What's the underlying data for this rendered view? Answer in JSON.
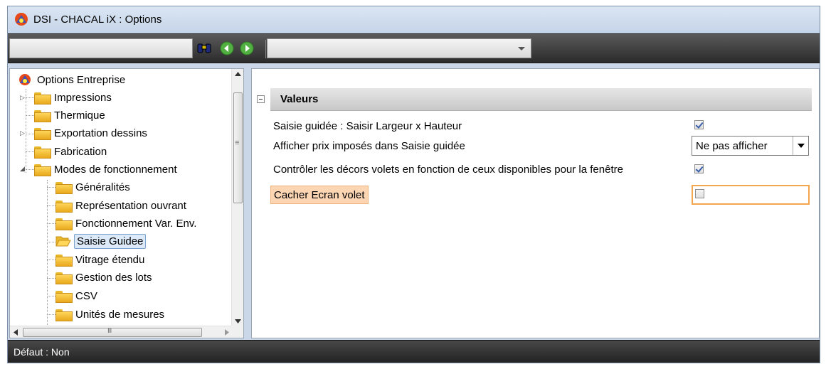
{
  "window": {
    "title": "DSI - CHACAL iX : Options"
  },
  "toolbar": {
    "search_value": "",
    "search_icon": "binoculars-icon",
    "back_icon": "back-arrow-icon",
    "forward_icon": "forward-arrow-icon",
    "combo_value": ""
  },
  "tree": {
    "root": "Options Entreprise",
    "items": [
      {
        "label": "Impressions",
        "expandable": true
      },
      {
        "label": "Thermique"
      },
      {
        "label": "Exportation dessins",
        "expandable": true
      },
      {
        "label": "Fabrication"
      },
      {
        "label": "Modes de fonctionnement",
        "expanded": true
      },
      {
        "label": "Généralités"
      },
      {
        "label": "Représentation ouvrant"
      },
      {
        "label": "Fonctionnement Var. Env."
      },
      {
        "label": "Saisie Guidee",
        "selected": true
      },
      {
        "label": "Vitrage étendu"
      },
      {
        "label": "Gestion des lots"
      },
      {
        "label": "CSV"
      },
      {
        "label": "Unités de mesures"
      }
    ],
    "hscroll_glyph": "III",
    "vscroll_glyph": "≡"
  },
  "properties": {
    "section_title": "Valeurs",
    "rows": [
      {
        "label": "Saisie guidée : Saisir Largeur x Hauteur",
        "type": "checkbox",
        "checked": true
      },
      {
        "label": "Afficher prix imposés dans Saisie guidée",
        "type": "select",
        "value": "Ne pas afficher"
      },
      {
        "label": "Contrôler les décors volets en fonction de ceux disponibles pour la fenêtre",
        "type": "checkbox",
        "checked": true
      },
      {
        "label": "Cacher Ecran volet",
        "type": "checkbox",
        "checked": false,
        "highlighted": true
      }
    ]
  },
  "status": {
    "text": "Défaut : Non"
  },
  "colors": {
    "highlight": "#fcd5b2",
    "focus_border": "#f3a64b",
    "toolbar_bg": "#3a3a3a",
    "window_bg": "#c9d7e8"
  }
}
